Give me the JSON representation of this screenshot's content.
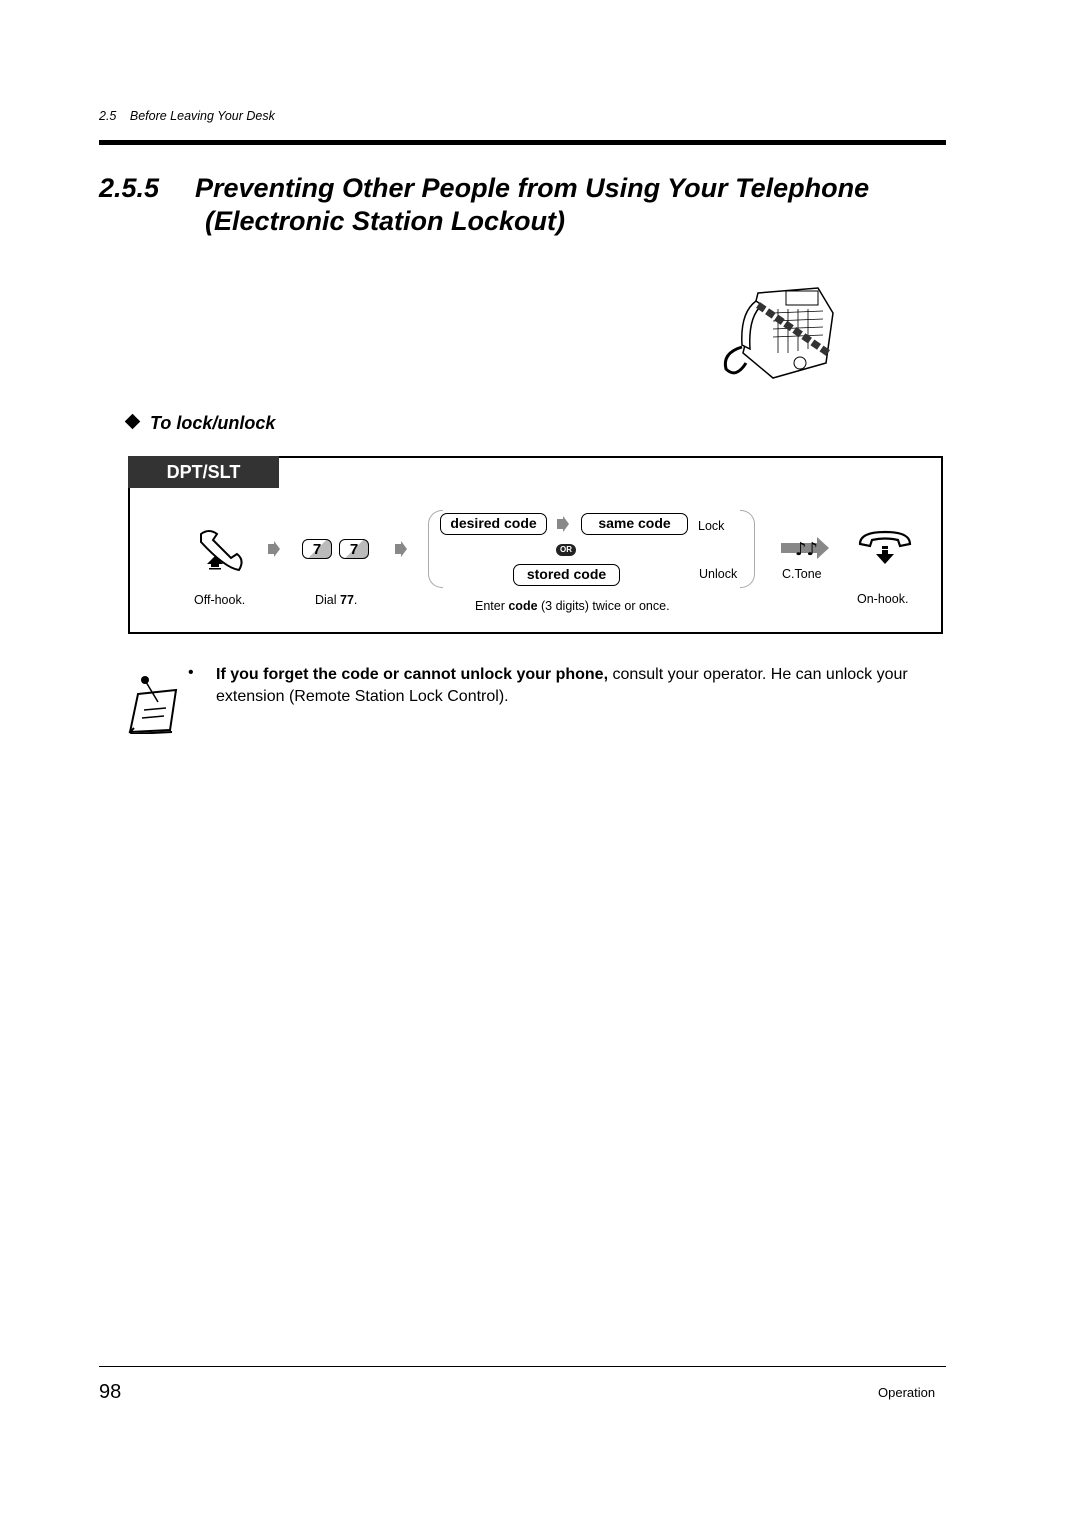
{
  "header": {
    "section_number": "2.5",
    "section_title": "Before Leaving Your Desk"
  },
  "title": {
    "number": "2.5.5",
    "line1": "Preventing Other People from Using Your Telephone",
    "line2": "(Electronic Station Lockout)"
  },
  "illustration": {
    "icon": "locked-telephone-with-chain"
  },
  "subheading": "To lock/unlock",
  "procedure": {
    "tab_label": "DPT/SLT",
    "steps": [
      {
        "icon": "off-hook-handset-icon",
        "caption": "Off-hook."
      },
      {
        "keys": [
          "7",
          "7"
        ],
        "caption_prefix": "Dial ",
        "caption_bold": "77",
        "caption_suffix": "."
      },
      {
        "lock": {
          "first": "desired code",
          "second": "same code",
          "label": "Lock"
        },
        "or_label": "OR",
        "unlock": {
          "code": "stored code",
          "label": "Unlock"
        },
        "caption_prefix": "Enter ",
        "caption_bold": "code",
        "caption_suffix": " (3 digits) twice or once."
      },
      {
        "icon": "confirmation-tone-icon",
        "caption": "C.Tone"
      },
      {
        "icon": "on-hook-handset-icon",
        "caption": "On-hook."
      }
    ]
  },
  "note": {
    "icon": "note-pad-icon",
    "bullet": "•",
    "bold": "If you forget the code or cannot unlock your phone,",
    "text": " consult your operator. He can unlock your extension (Remote Station Lock Control)."
  },
  "footer": {
    "page_number": "98",
    "section": "Operation"
  }
}
